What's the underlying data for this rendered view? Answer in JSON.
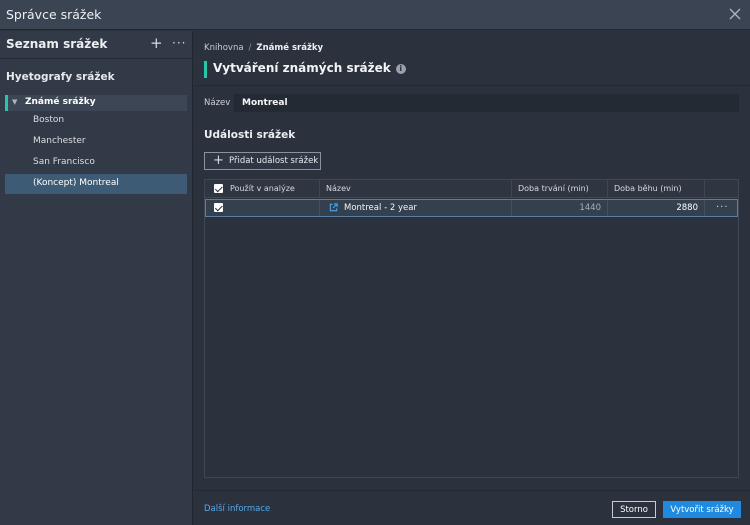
{
  "window": {
    "title": "Správce srážek"
  },
  "sidebar": {
    "title": "Seznam srážek",
    "add_icon": "+",
    "more_icon": "···",
    "section": "Hyetografy srážek",
    "group": {
      "label": "Známé srážky",
      "caret": "▼"
    },
    "items": [
      {
        "label": "Boston"
      },
      {
        "label": "Manchester"
      },
      {
        "label": "San Francisco"
      },
      {
        "label": "(Koncept) Montreal"
      }
    ]
  },
  "main": {
    "breadcrumb": {
      "root": "Knihovna",
      "separator": "/",
      "current": "Známé srážky"
    },
    "title": "Vytváření známých srážek",
    "info_icon": "i",
    "name_label": "Název",
    "name_value": "Montreal",
    "events_title": "Události srážek",
    "add_event": {
      "icon": "+",
      "label": "Přidat událost srážek"
    },
    "table": {
      "headers": [
        "Použít v analýze",
        "Název",
        "Doba trvání (min)",
        "Doba běhu (min)"
      ],
      "rows": [
        {
          "use": true,
          "name": "Montreal - 2 year",
          "duration": "1440",
          "run_time": "2880",
          "menu": "···"
        }
      ]
    },
    "footer": {
      "more_info": "Další informace",
      "cancel": "Storno",
      "create": "Vytvořit srážky"
    }
  },
  "colors": {
    "accent": "#25c7a8",
    "primary": "#1f8ae0",
    "link": "#58a8e8",
    "selection": "#3d5b75"
  }
}
